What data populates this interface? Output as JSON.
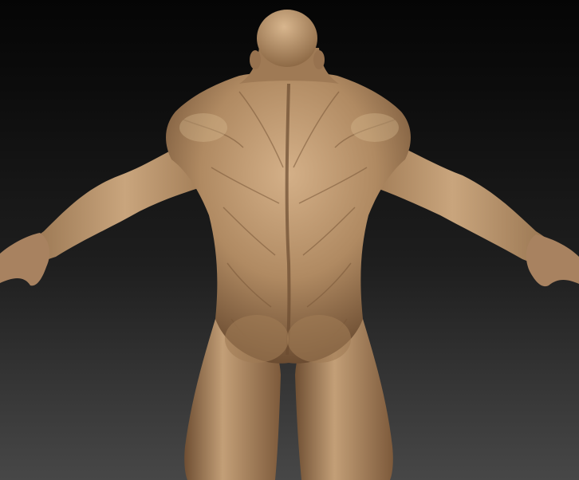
{
  "viewport": {
    "background_top": "#050505",
    "background_bottom": "#474747"
  },
  "model": {
    "material_base": "#b08a62",
    "material_highlight": "#d9b88f",
    "material_shadow": "#6b4c31"
  }
}
